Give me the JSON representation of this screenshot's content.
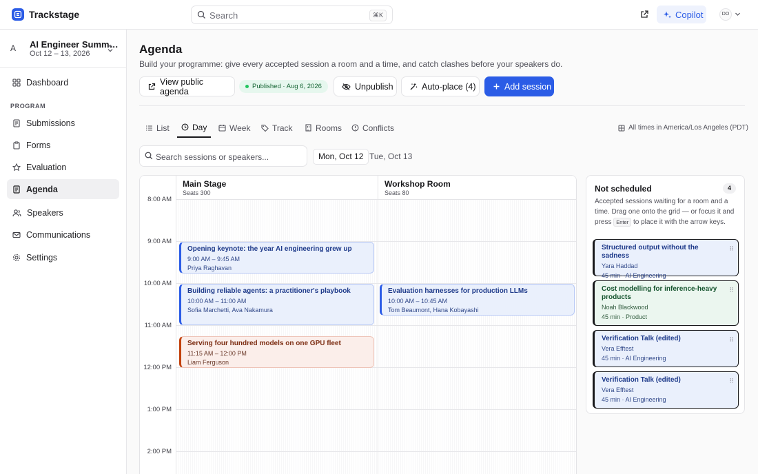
{
  "app": {
    "name": "Trackstage"
  },
  "topbar": {
    "search_placeholder": "Search",
    "search_shortcut": "⌘K",
    "copilot_label": "Copilot",
    "avatar_initials": "DO"
  },
  "event": {
    "initial": "A",
    "name": "AI Engineer Summ…",
    "dates": "Oct 12 – 13, 2026"
  },
  "sidebar": {
    "dashboard": "Dashboard",
    "group_label": "PROGRAM",
    "items": [
      {
        "label": "Submissions",
        "icon": "submissions-icon"
      },
      {
        "label": "Forms",
        "icon": "forms-icon"
      },
      {
        "label": "Evaluation",
        "icon": "star-icon"
      },
      {
        "label": "Agenda",
        "icon": "agenda-icon",
        "active": true
      },
      {
        "label": "Speakers",
        "icon": "speakers-icon"
      },
      {
        "label": "Communications",
        "icon": "mail-icon"
      },
      {
        "label": "Settings",
        "icon": "gear-icon"
      }
    ]
  },
  "page": {
    "title": "Agenda",
    "subtitle": "Build your programme: give every accepted session a room and a time, and catch clashes before your speakers do."
  },
  "actions": {
    "view_public": "View public agenda",
    "published_badge": "Published · Aug 6, 2026",
    "unpublish": "Unpublish",
    "auto_place": "Auto-place (4)",
    "add_session": "Add session"
  },
  "tabs": [
    "List",
    "Day",
    "Week",
    "Track",
    "Rooms",
    "Conflicts"
  ],
  "active_tab": "Day",
  "timezone": "All times in America/Los Angeles (PDT)",
  "session_search_placeholder": "Search sessions or speakers...",
  "days": [
    "Mon, Oct 12",
    "Tue, Oct 13"
  ],
  "active_day": "Mon, Oct 12",
  "rooms": [
    {
      "name": "Main Stage",
      "seats": "Seats 300"
    },
    {
      "name": "Workshop Room",
      "seats": "Seats 80"
    }
  ],
  "times": [
    "8:00 AM",
    "9:00 AM",
    "10:00 AM",
    "11:00 AM",
    "12:00 PM",
    "1:00 PM",
    "2:00 PM"
  ],
  "sessions": [
    {
      "title": "Opening keynote: the year AI engineering grew up",
      "time": "9:00 AM – 9:45 AM",
      "speakers": "Priya Raghavan",
      "room": 0,
      "color": "blue"
    },
    {
      "title": "Building reliable agents: a practitioner's playbook",
      "time": "10:00 AM – 11:00 AM",
      "speakers": "Sofia Marchetti, Ava Nakamura",
      "room": 0,
      "color": "blue"
    },
    {
      "title": "Evaluation harnesses for production LLMs",
      "time": "10:00 AM – 10:45 AM",
      "speakers": "Tom Beaumont, Hana Kobayashi",
      "room": 1,
      "color": "blue"
    },
    {
      "title": "Serving four hundred models on one GPU fleet",
      "time": "11:15 AM – 12:00 PM",
      "speakers": "Liam Ferguson",
      "room": 0,
      "color": "red"
    }
  ],
  "unscheduled": {
    "title": "Not scheduled",
    "count": "4",
    "desc_before": "Accepted sessions waiting for a room and a time. Drag one onto the grid — or focus it and press",
    "desc_key": "Enter",
    "desc_after": "to place it with the arrow keys.",
    "items": [
      {
        "title": "Structured output without the sadness",
        "speaker": "Yara Haddad",
        "meta": "45 min · AI Engineering",
        "color": "blue"
      },
      {
        "title": "Cost modelling for inference-heavy products",
        "speaker": "Noah Blackwood",
        "meta": "45 min · Product",
        "color": "green"
      },
      {
        "title": "Verification Talk (edited)",
        "speaker": "Vera Efftest",
        "meta": "45 min · AI Engineering",
        "color": "blue"
      },
      {
        "title": "Verification Talk (edited)",
        "speaker": "Vera Efftest",
        "meta": "45 min · AI Engineering",
        "color": "blue"
      }
    ]
  },
  "colors": {
    "accent": "#2b5ce6",
    "published": "#22c55e",
    "conflict": "#c2410c",
    "product": "#16a34a"
  }
}
